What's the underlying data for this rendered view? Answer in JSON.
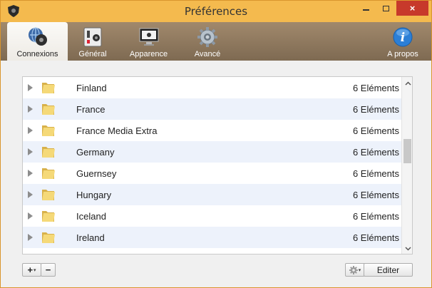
{
  "window": {
    "title": "Préférences",
    "close_glyph": "×"
  },
  "tabs": [
    {
      "label": "Connexions",
      "icon": "globe-network-icon",
      "active": true
    },
    {
      "label": "Général",
      "icon": "switches-icon",
      "active": false
    },
    {
      "label": "Apparence",
      "icon": "monitor-icon",
      "active": false
    },
    {
      "label": "Avancé",
      "icon": "gear-icon",
      "active": false
    },
    {
      "label": "A propos",
      "icon": "info-icon",
      "active": false
    }
  ],
  "list": {
    "rows": [
      {
        "name": "Finland",
        "count": "6 Eléments"
      },
      {
        "name": "France",
        "count": "6 Eléments"
      },
      {
        "name": "France Media Extra",
        "count": "6 Eléments"
      },
      {
        "name": "Germany",
        "count": "6 Eléments"
      },
      {
        "name": "Guernsey",
        "count": "6 Eléments"
      },
      {
        "name": "Hungary",
        "count": "6 Eléments"
      },
      {
        "name": "Iceland",
        "count": "6 Eléments"
      },
      {
        "name": "Ireland",
        "count": "6 Eléments"
      }
    ]
  },
  "footer": {
    "add_label": "+",
    "caret": "▾",
    "remove_label": "−",
    "edit_label": "Editer"
  },
  "colors": {
    "window_frame": "#f4ba4e",
    "toolbar": "#8d775c",
    "close_button": "#c7392b",
    "row_alt": "#edf2fb",
    "info_blue": "#2c7fd6"
  }
}
